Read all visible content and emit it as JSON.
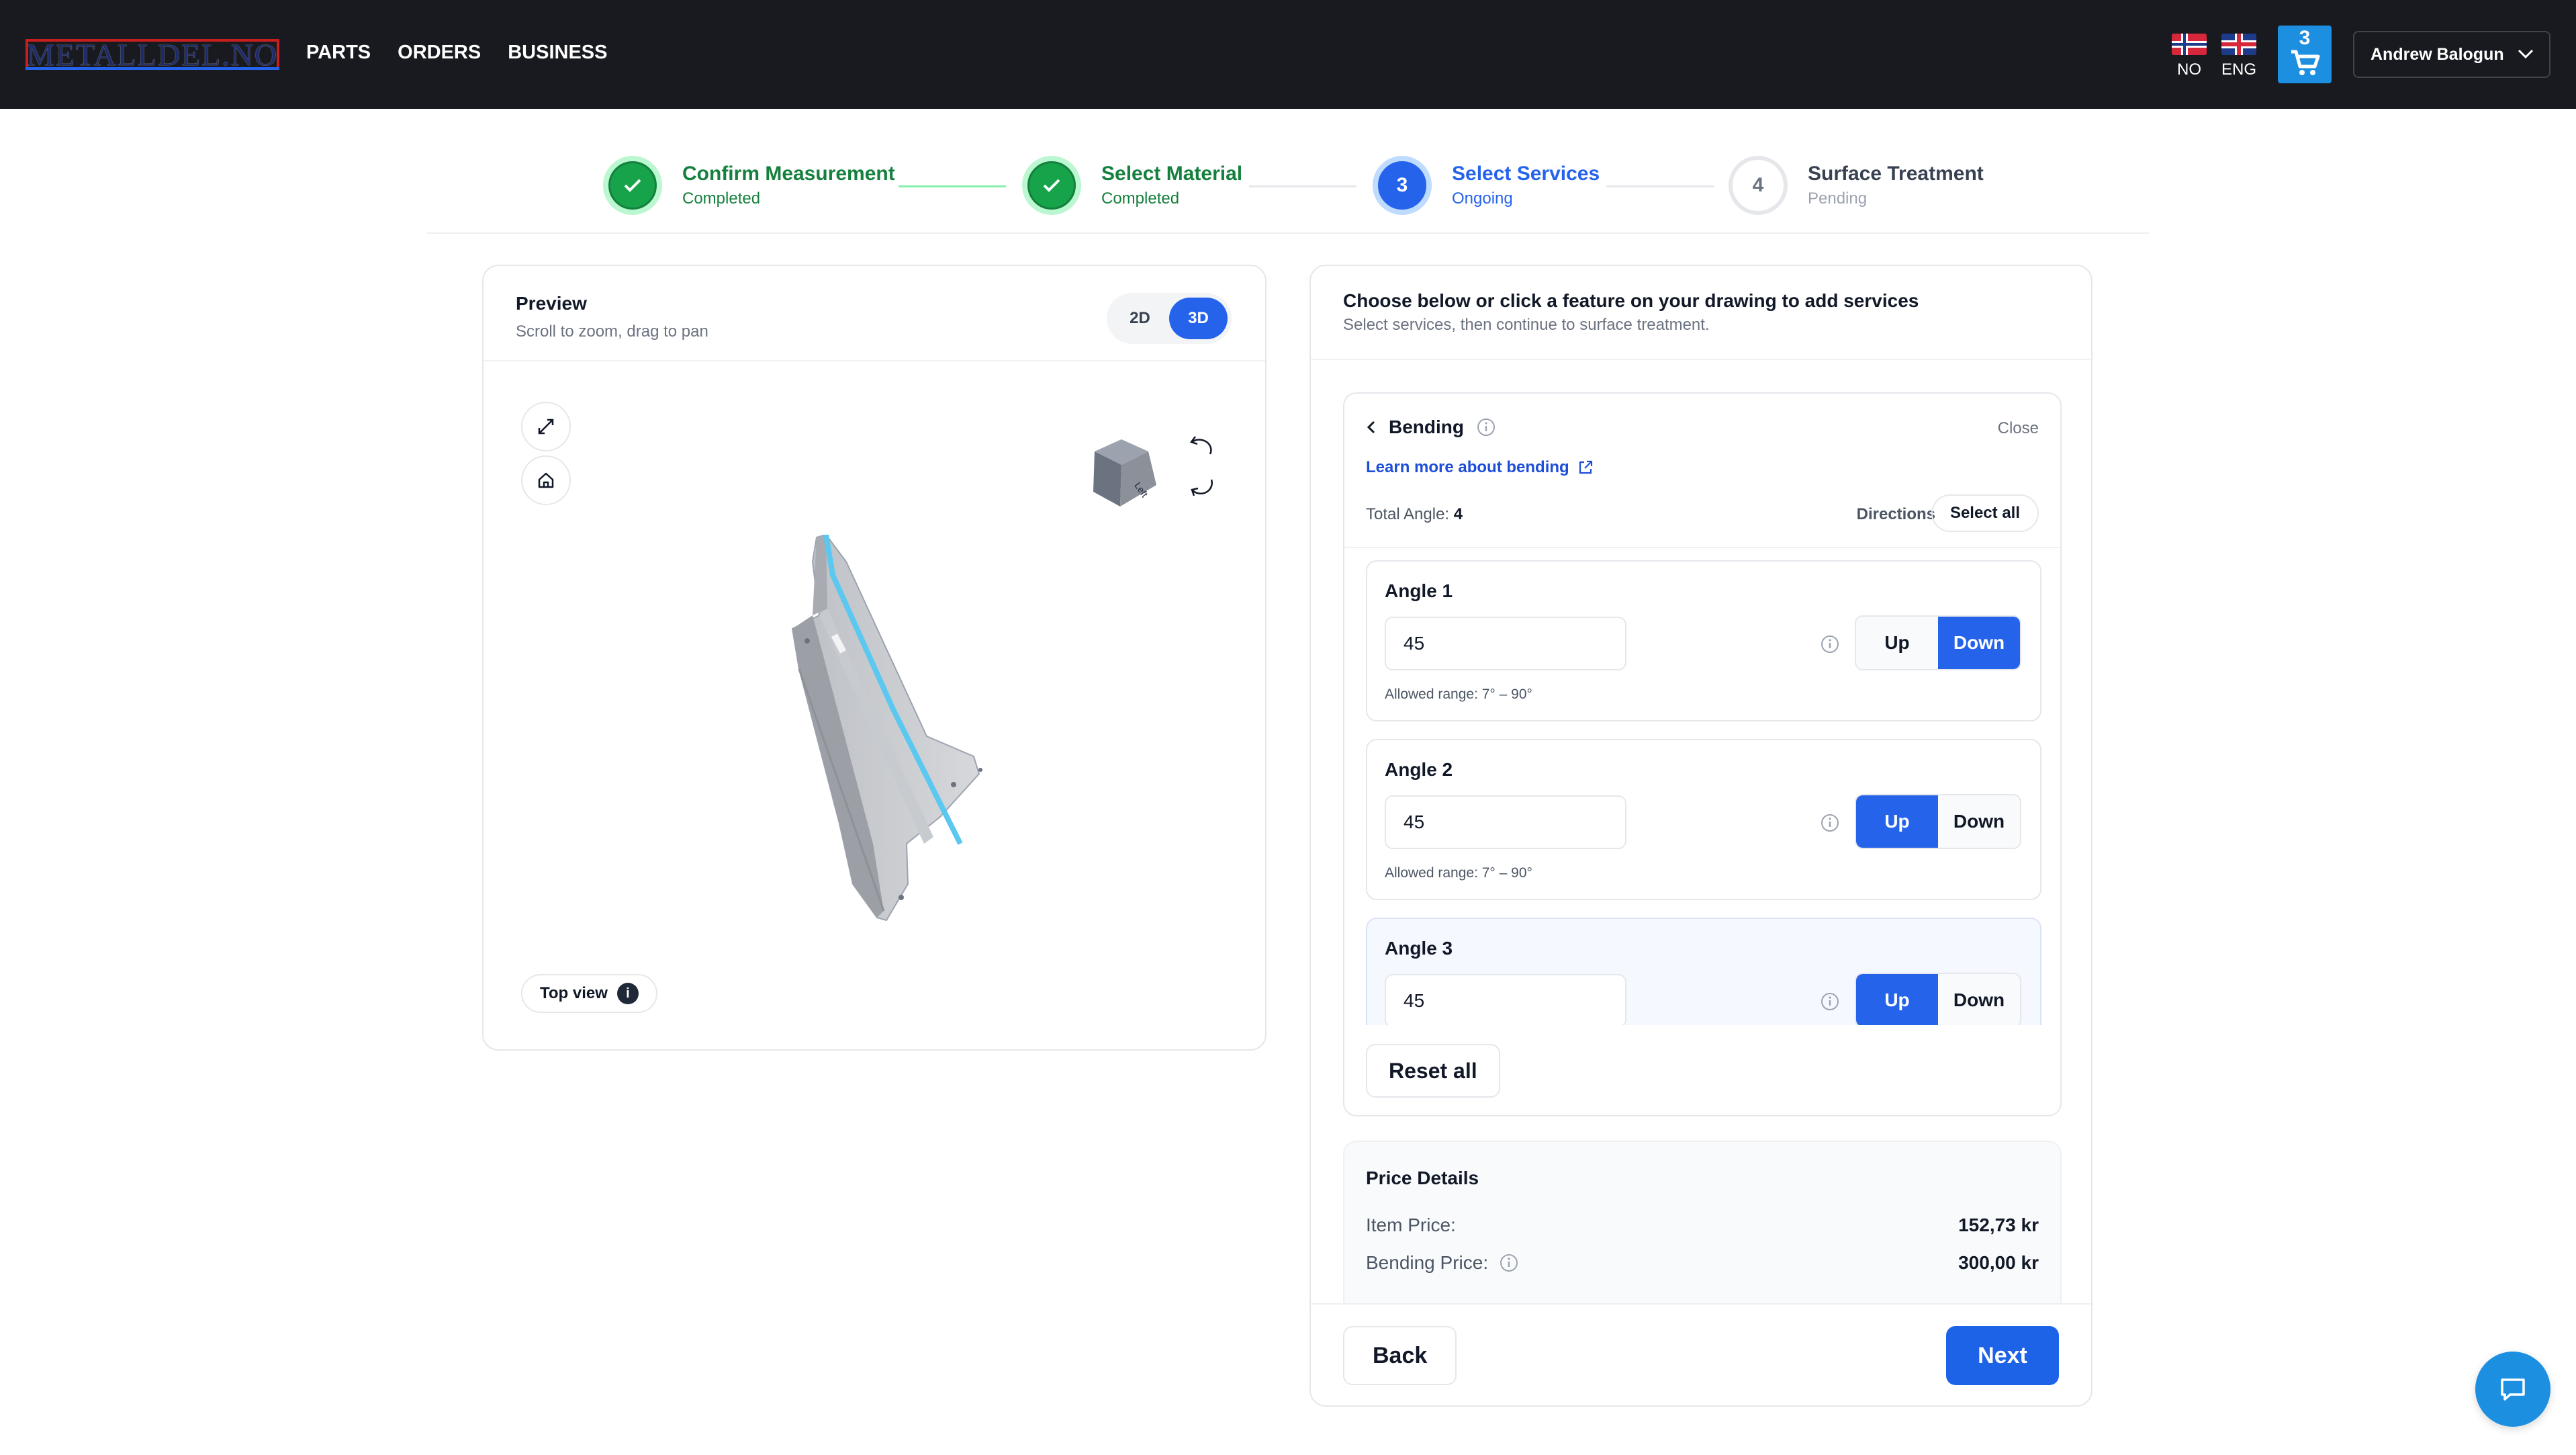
{
  "header": {
    "logo_text": "METALLDEL.NO",
    "nav": [
      "PARTS",
      "ORDERS",
      "BUSINESS"
    ],
    "languages": [
      "NO",
      "ENG"
    ],
    "cart_count": "3",
    "user_name": "Andrew Balogun"
  },
  "stepper": [
    {
      "num": "",
      "title": "Confirm Measurement",
      "status": "Completed",
      "state": "done"
    },
    {
      "num": "",
      "title": "Select Material",
      "status": "Completed",
      "state": "done"
    },
    {
      "num": "3",
      "title": "Select Services",
      "status": "Ongoing",
      "state": "current"
    },
    {
      "num": "4",
      "title": "Surface Treatment",
      "status": "Pending",
      "state": "pending"
    }
  ],
  "preview": {
    "title": "Preview",
    "subtitle": "Scroll to zoom, drag to pan",
    "toggle": [
      "2D",
      "3D"
    ],
    "active_toggle": "3D",
    "cube_face": "Left",
    "top_view_label": "Top view",
    "top_view_info": "i"
  },
  "services": {
    "title": "Choose below or click a feature on your drawing to add services",
    "subtitle": "Select services, then continue to surface treatment.",
    "bending": {
      "title": "Bending",
      "close": "Close",
      "learn_more": "Learn more about bending",
      "total_label": "Total Angle:",
      "total_value": "4",
      "directions": "Directions",
      "select_all": "Select all",
      "up_label": "Up",
      "down_label": "Down",
      "angles": [
        {
          "label": "Angle 1",
          "value": "45",
          "range": "Allowed range: 7° – 90°",
          "direction": "Down"
        },
        {
          "label": "Angle 2",
          "value": "45",
          "range": "Allowed range: 7° – 90°",
          "direction": "Up"
        },
        {
          "label": "Angle 3",
          "value": "45",
          "range": "",
          "direction": "Up"
        }
      ],
      "reset": "Reset all"
    },
    "price": {
      "title": "Price Details",
      "item_label": "Item Price:",
      "item_value": "152,73 kr",
      "bending_label": "Bending Price:",
      "bending_value": "300,00 kr"
    },
    "back": "Back",
    "next": "Next"
  },
  "colors": {
    "primary": "#2563eb",
    "success": "#16a34a",
    "header": "#181a1f",
    "cart": "#1d8fe0"
  }
}
